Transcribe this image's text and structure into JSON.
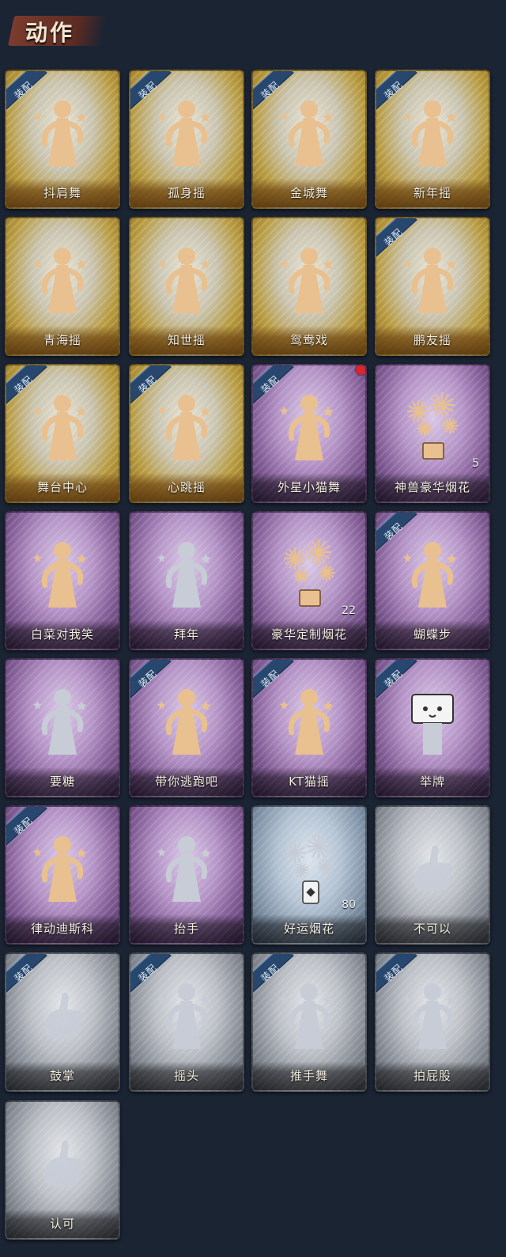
{
  "header": {
    "title": "动作"
  },
  "equip_text": "装配",
  "colors": {
    "gold": "#c7a33c",
    "purple": "#9a74b0",
    "blue": "#9fb2c6",
    "gray": "#aeb2b8",
    "figure_gold": "#e9c08f",
    "figure_silver": "#c7ccd6",
    "badge": "#27476e",
    "notification": "#d8262c"
  },
  "cards": [
    {
      "label": "抖肩舞",
      "tier": "gold",
      "equipped": true,
      "icon": "dance-figure-icon",
      "figure": "gold"
    },
    {
      "label": "孤身摇",
      "tier": "gold",
      "equipped": true,
      "icon": "dance-figure-icon",
      "figure": "gold"
    },
    {
      "label": "金城舞",
      "tier": "gold",
      "equipped": true,
      "icon": "dance-figure-icon",
      "figure": "gold"
    },
    {
      "label": "新年摇",
      "tier": "gold",
      "equipped": true,
      "icon": "dance-figure-icon",
      "figure": "gold"
    },
    {
      "label": "青海摇",
      "tier": "gold",
      "equipped": false,
      "icon": "dance-figure-icon",
      "figure": "gold"
    },
    {
      "label": "知世摇",
      "tier": "gold",
      "equipped": false,
      "icon": "dance-figure-icon",
      "figure": "gold"
    },
    {
      "label": "鸳鸯戏",
      "tier": "gold",
      "equipped": false,
      "icon": "dance-figure-icon",
      "figure": "gold"
    },
    {
      "label": "鹏友摇",
      "tier": "gold",
      "equipped": true,
      "icon": "dance-figure-icon",
      "figure": "gold"
    },
    {
      "label": "舞台中心",
      "tier": "gold",
      "equipped": true,
      "icon": "dance-figure-icon",
      "figure": "gold"
    },
    {
      "label": "心跳摇",
      "tier": "gold",
      "equipped": true,
      "icon": "dance-figure-icon",
      "figure": "gold"
    },
    {
      "label": "外星小猫舞",
      "tier": "purple",
      "equipped": true,
      "icon": "dance-figure-icon",
      "figure": "gold",
      "notification": true
    },
    {
      "label": "神兽豪华烟花",
      "tier": "purple",
      "equipped": false,
      "icon": "fireworks-icon",
      "figure": "gold",
      "count": "5"
    },
    {
      "label": "白菜对我笑",
      "tier": "purple",
      "equipped": false,
      "icon": "dance-figure-icon",
      "figure": "gold"
    },
    {
      "label": "拜年",
      "tier": "purple",
      "equipped": false,
      "icon": "bow-figure-icon",
      "figure": "silver"
    },
    {
      "label": "豪华定制烟花",
      "tier": "purple",
      "equipped": false,
      "icon": "fireworks-box-icon",
      "figure": "gold",
      "count": "22"
    },
    {
      "label": "蝴蝶步",
      "tier": "purple",
      "equipped": true,
      "icon": "dance-figure-icon",
      "figure": "gold"
    },
    {
      "label": "要糖",
      "tier": "purple",
      "equipped": false,
      "icon": "ask-figure-icon",
      "figure": "silver"
    },
    {
      "label": "带你逃跑吧",
      "tier": "purple",
      "equipped": true,
      "icon": "dance-figure-icon",
      "figure": "gold"
    },
    {
      "label": "KT猫摇",
      "tier": "purple",
      "equipped": true,
      "icon": "dance-figure-icon",
      "figure": "gold"
    },
    {
      "label": "举牌",
      "tier": "purple",
      "equipped": true,
      "icon": "sign-figure-icon",
      "figure": "silver"
    },
    {
      "label": "律动迪斯科",
      "tier": "purple",
      "equipped": true,
      "icon": "disco-figure-icon",
      "figure": "gold"
    },
    {
      "label": "抬手",
      "tier": "purple",
      "equipped": false,
      "icon": "raise-hand-icon",
      "figure": "silver"
    },
    {
      "label": "好运烟花",
      "tier": "blue",
      "equipped": false,
      "icon": "firework-can-icon",
      "figure": "silver",
      "count": "80"
    },
    {
      "label": "不可以",
      "tier": "gray",
      "equipped": false,
      "icon": "finger-wag-icon",
      "figure": "silver"
    },
    {
      "label": "鼓掌",
      "tier": "gray",
      "equipped": true,
      "icon": "clap-icon",
      "figure": "silver"
    },
    {
      "label": "摇头",
      "tier": "gray",
      "equipped": true,
      "icon": "shake-head-icon",
      "figure": "silver"
    },
    {
      "label": "推手舞",
      "tier": "gray",
      "equipped": true,
      "icon": "push-dance-icon",
      "figure": "silver"
    },
    {
      "label": "拍屁股",
      "tier": "gray",
      "equipped": true,
      "icon": "pat-icon",
      "figure": "silver"
    },
    {
      "label": "认可",
      "tier": "gray",
      "equipped": false,
      "icon": "thumbs-up-icon",
      "figure": "silver"
    }
  ]
}
